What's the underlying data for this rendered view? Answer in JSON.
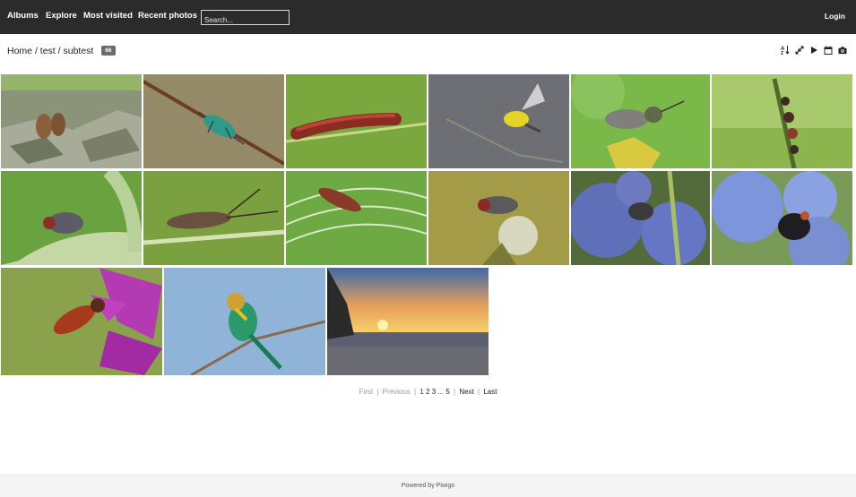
{
  "nav": {
    "albums": "Albums",
    "explore": "Explore",
    "most_visited": "Most visited",
    "recent_photos": "Recent photos",
    "search_placeholder": "Search...",
    "login": "Login"
  },
  "breadcrumb": {
    "home": "Home",
    "sep1": "/",
    "album": "test",
    "sep2": "/",
    "current": "subtest",
    "photo_count": "66"
  },
  "toolbar_icons": [
    "sort-order-icon",
    "slideshow-mode-icon",
    "play-icon",
    "calendar-icon",
    "camera-icon"
  ],
  "thumbnails": [
    {
      "name": "marmots-on-rocks",
      "bg": "#8a9270"
    },
    {
      "name": "green-weevil-on-twig",
      "bg": "#9c8869"
    },
    {
      "name": "red-caterpillar-on-stem",
      "bg": "#7aa83e"
    },
    {
      "name": "wagtail-bird-on-branch",
      "bg": "#6f6f74"
    },
    {
      "name": "horse-fly-on-flower",
      "bg": "#79b54a"
    },
    {
      "name": "aphids-on-stem",
      "bg": "#a8c86a"
    },
    {
      "name": "fly-on-leaf",
      "bg": "#6da13f"
    },
    {
      "name": "longhorn-beetle-on-grass",
      "bg": "#73993c"
    },
    {
      "name": "red-beetle-dewdrops",
      "bg": "#6fab47"
    },
    {
      "name": "fly-on-seedhead",
      "bg": "#a39a46"
    },
    {
      "name": "bee-on-blue-geranium",
      "bg": "#5c6cb2"
    },
    {
      "name": "bumblebee-in-blue-flower",
      "bg": "#6f8bd0"
    },
    {
      "name": "hornet-fly-on-purple-flower",
      "bg": "#8aa04a"
    },
    {
      "name": "bee-eater-bird",
      "bg": "#92b6d8"
    },
    {
      "name": "sunset-over-beach",
      "bg": "#5f6f92"
    }
  ],
  "pagination": {
    "first": "First",
    "previous": "Previous",
    "p1": "1",
    "p2": "2",
    "p3": "3",
    "ellipsis": "...",
    "p5": "5",
    "next": "Next",
    "last": "Last",
    "bar": "|"
  },
  "footer": {
    "text": "Powered by Piwigo"
  }
}
